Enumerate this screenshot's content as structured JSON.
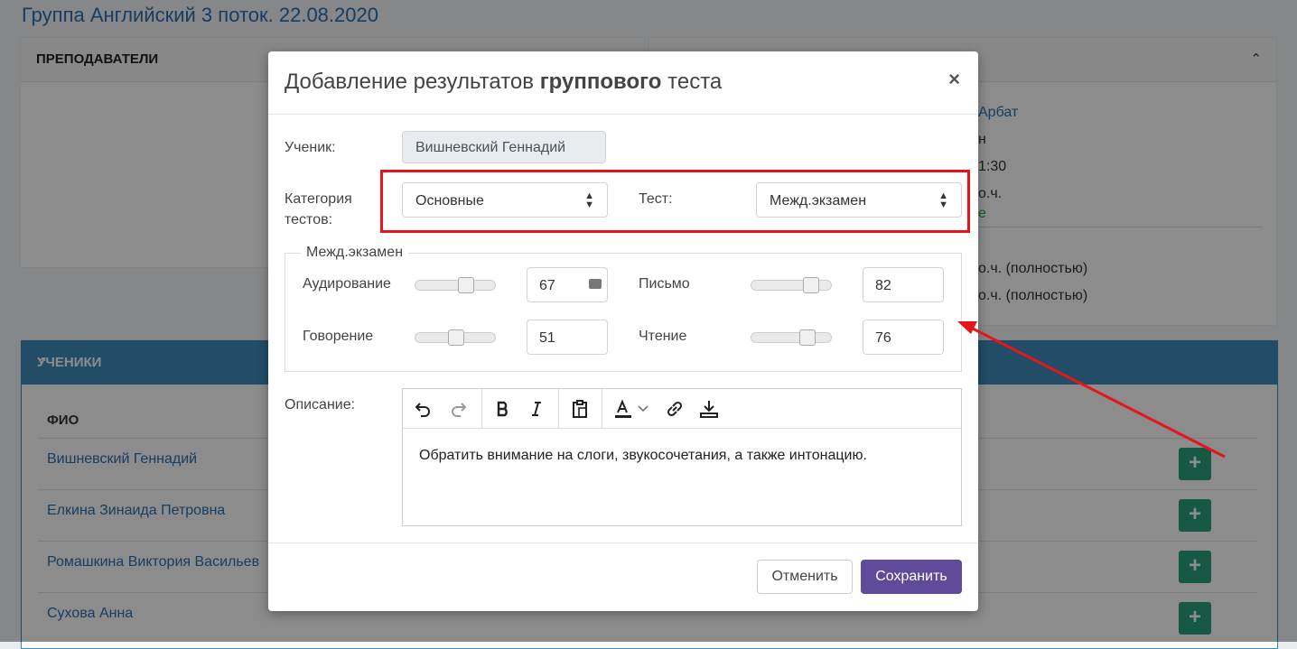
{
  "page": {
    "title_link": "Группа Английский 3 поток",
    "title_date": ". 22.08.2020"
  },
  "teachers_card": {
    "title": "ПРЕПОДАВАТЕЛИ"
  },
  "info_card": {
    "lines": [
      "Арбат",
      "н",
      "1:30",
      "о.ч.",
      "е",
      "о.ч. (полностью)",
      "о.ч. (полностью)"
    ]
  },
  "students_card": {
    "title": "УЧЕНИКИ",
    "column_fio": "ФИО",
    "students": [
      "Вишневский Геннадий",
      "Елкина Зинаида Петровна",
      "Ромашкина Виктория Васильев",
      "Сухова Анна"
    ],
    "add_symbol": "+"
  },
  "modal": {
    "title_start": "Добавление результатов ",
    "title_bold": "группового",
    "title_end": " теста",
    "close": "×",
    "student_label": "Ученик:",
    "student_value": "Вишневский Геннадий",
    "category_label_1": "Категория",
    "category_label_2": "тестов:",
    "category_value": "Основные",
    "test_label": "Тест:",
    "test_value": "Межд.экзамен",
    "section_legend": "Межд.экзамен",
    "scores": {
      "listening": {
        "label": "Аудирование",
        "value": "67",
        "fraction": 0.67
      },
      "writing": {
        "label": "Письмо",
        "value": "82",
        "fraction": 0.82
      },
      "speaking": {
        "label": "Говорение",
        "value": "51",
        "fraction": 0.51
      },
      "reading": {
        "label": "Чтение",
        "value": "76",
        "fraction": 0.76
      }
    },
    "description_label": "Описание:",
    "description_text": "Обратить внимание на слоги, звукосочетания, а также интонацию.",
    "cancel_label": "Отменить",
    "save_label": "Сохранить"
  },
  "colors": {
    "accent": "#3c8dbc",
    "save": "#5f4b9a",
    "add_button": "#28a07a",
    "highlight": "#e8141b"
  }
}
